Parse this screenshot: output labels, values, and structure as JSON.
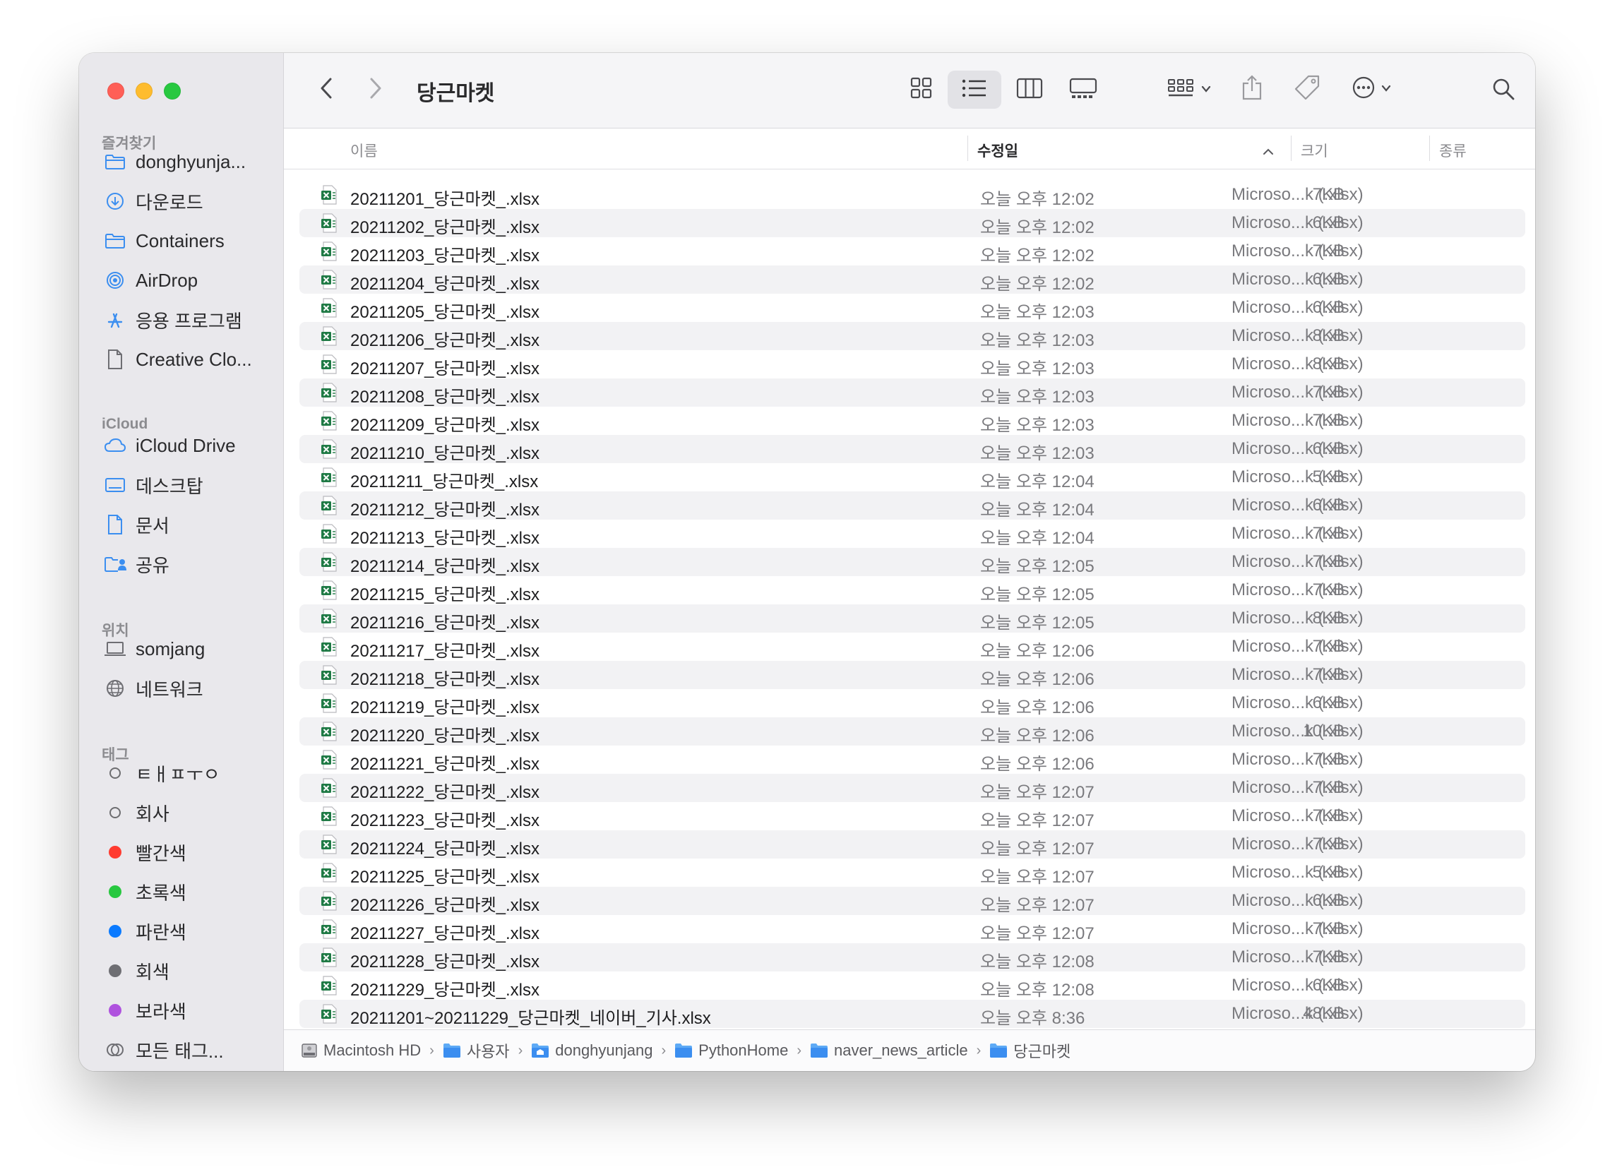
{
  "window": {
    "title": "당근마켓"
  },
  "colors": {
    "close": "#ff5f57",
    "minimize": "#febc2e",
    "zoom": "#28c840",
    "folder_accent": "#3b8ef0",
    "excel_green": "#1f7a45",
    "tag_red": "#ff3b30",
    "tag_green": "#28c840",
    "tag_blue": "#0a7aff",
    "tag_gray": "#8e8e93",
    "tag_purple": "#af52de"
  },
  "sidebar": {
    "favorites_title": "즐겨찾기",
    "favorites": [
      {
        "label": "donghyunja...",
        "icon": "folder-icon"
      },
      {
        "label": "다운로드",
        "icon": "download-icon"
      },
      {
        "label": "Containers",
        "icon": "folder-icon"
      },
      {
        "label": "AirDrop",
        "icon": "airdrop-icon"
      },
      {
        "label": "응용 프로그램",
        "icon": "applications-icon"
      },
      {
        "label": "Creative Clo...",
        "icon": "document-icon"
      }
    ],
    "icloud_title": "iCloud",
    "icloud": [
      {
        "label": "iCloud Drive",
        "icon": "cloud-icon"
      },
      {
        "label": "데스크탑",
        "icon": "desktop-icon"
      },
      {
        "label": "문서",
        "icon": "document-icon"
      },
      {
        "label": "공유",
        "icon": "shared-folder-icon"
      }
    ],
    "locations_title": "위치",
    "locations": [
      {
        "label": "somjang",
        "icon": "laptop-icon"
      },
      {
        "label": "네트워크",
        "icon": "network-icon"
      }
    ],
    "tags_title": "태그",
    "tags": [
      {
        "label": "ㅌㅐㅍㅜㅇ",
        "color": "none"
      },
      {
        "label": "회사",
        "color": "none"
      },
      {
        "label": "빨간색",
        "color": "#ff3b30"
      },
      {
        "label": "초록색",
        "color": "#28c840"
      },
      {
        "label": "파란색",
        "color": "#0a7aff"
      },
      {
        "label": "회색",
        "color": "#6e6e73"
      },
      {
        "label": "보라색",
        "color": "#af52de"
      },
      {
        "label": "모든 태그...",
        "color": "all"
      }
    ]
  },
  "columns": {
    "name": "이름",
    "date": "수정일",
    "size": "크기",
    "kind": "종류"
  },
  "files": [
    {
      "name": "20211201_당근마켓_.xlsx",
      "date": "오늘 오후 12:02",
      "size": "7KB",
      "kind": "Microso...k (.xlsx)"
    },
    {
      "name": "20211202_당근마켓_.xlsx",
      "date": "오늘 오후 12:02",
      "size": "6KB",
      "kind": "Microso...k (.xlsx)"
    },
    {
      "name": "20211203_당근마켓_.xlsx",
      "date": "오늘 오후 12:02",
      "size": "7KB",
      "kind": "Microso...k (.xlsx)"
    },
    {
      "name": "20211204_당근마켓_.xlsx",
      "date": "오늘 오후 12:02",
      "size": "6KB",
      "kind": "Microso...k (.xlsx)"
    },
    {
      "name": "20211205_당근마켓_.xlsx",
      "date": "오늘 오후 12:03",
      "size": "6KB",
      "kind": "Microso...k (.xlsx)"
    },
    {
      "name": "20211206_당근마켓_.xlsx",
      "date": "오늘 오후 12:03",
      "size": "8KB",
      "kind": "Microso...k (.xlsx)"
    },
    {
      "name": "20211207_당근마켓_.xlsx",
      "date": "오늘 오후 12:03",
      "size": "8KB",
      "kind": "Microso...k (.xlsx)"
    },
    {
      "name": "20211208_당근마켓_.xlsx",
      "date": "오늘 오후 12:03",
      "size": "7KB",
      "kind": "Microso...k (.xlsx)"
    },
    {
      "name": "20211209_당근마켓_.xlsx",
      "date": "오늘 오후 12:03",
      "size": "7KB",
      "kind": "Microso...k (.xlsx)"
    },
    {
      "name": "20211210_당근마켓_.xlsx",
      "date": "오늘 오후 12:03",
      "size": "6KB",
      "kind": "Microso...k (.xlsx)"
    },
    {
      "name": "20211211_당근마켓_.xlsx",
      "date": "오늘 오후 12:04",
      "size": "5KB",
      "kind": "Microso...k (.xlsx)"
    },
    {
      "name": "20211212_당근마켓_.xlsx",
      "date": "오늘 오후 12:04",
      "size": "6KB",
      "kind": "Microso...k (.xlsx)"
    },
    {
      "name": "20211213_당근마켓_.xlsx",
      "date": "오늘 오후 12:04",
      "size": "7KB",
      "kind": "Microso...k (.xlsx)"
    },
    {
      "name": "20211214_당근마켓_.xlsx",
      "date": "오늘 오후 12:05",
      "size": "7KB",
      "kind": "Microso...k (.xlsx)"
    },
    {
      "name": "20211215_당근마켓_.xlsx",
      "date": "오늘 오후 12:05",
      "size": "7KB",
      "kind": "Microso...k (.xlsx)"
    },
    {
      "name": "20211216_당근마켓_.xlsx",
      "date": "오늘 오후 12:05",
      "size": "8KB",
      "kind": "Microso...k (.xlsx)"
    },
    {
      "name": "20211217_당근마켓_.xlsx",
      "date": "오늘 오후 12:06",
      "size": "7KB",
      "kind": "Microso...k (.xlsx)"
    },
    {
      "name": "20211218_당근마켓_.xlsx",
      "date": "오늘 오후 12:06",
      "size": "7KB",
      "kind": "Microso...k (.xlsx)"
    },
    {
      "name": "20211219_당근마켓_.xlsx",
      "date": "오늘 오후 12:06",
      "size": "6KB",
      "kind": "Microso...k (.xlsx)"
    },
    {
      "name": "20211220_당근마켓_.xlsx",
      "date": "오늘 오후 12:06",
      "size": "10KB",
      "kind": "Microso...k (.xlsx)"
    },
    {
      "name": "20211221_당근마켓_.xlsx",
      "date": "오늘 오후 12:06",
      "size": "7KB",
      "kind": "Microso...k (.xlsx)"
    },
    {
      "name": "20211222_당근마켓_.xlsx",
      "date": "오늘 오후 12:07",
      "size": "7KB",
      "kind": "Microso...k (.xlsx)"
    },
    {
      "name": "20211223_당근마켓_.xlsx",
      "date": "오늘 오후 12:07",
      "size": "7KB",
      "kind": "Microso...k (.xlsx)"
    },
    {
      "name": "20211224_당근마켓_.xlsx",
      "date": "오늘 오후 12:07",
      "size": "7KB",
      "kind": "Microso...k (.xlsx)"
    },
    {
      "name": "20211225_당근마켓_.xlsx",
      "date": "오늘 오후 12:07",
      "size": "5KB",
      "kind": "Microso...k (.xlsx)"
    },
    {
      "name": "20211226_당근마켓_.xlsx",
      "date": "오늘 오후 12:07",
      "size": "6KB",
      "kind": "Microso...k (.xlsx)"
    },
    {
      "name": "20211227_당근마켓_.xlsx",
      "date": "오늘 오후 12:07",
      "size": "7KB",
      "kind": "Microso...k (.xlsx)"
    },
    {
      "name": "20211228_당근마켓_.xlsx",
      "date": "오늘 오후 12:08",
      "size": "7KB",
      "kind": "Microso...k (.xlsx)"
    },
    {
      "name": "20211229_당근마켓_.xlsx",
      "date": "오늘 오후 12:08",
      "size": "6KB",
      "kind": "Microso...k (.xlsx)"
    },
    {
      "name": "20211201~20211229_당근마켓_네이버_기사.xlsx",
      "date": "오늘 오후 8:36",
      "size": "48KB",
      "kind": "Microso...k (.xlsx)"
    }
  ],
  "pathbar": [
    {
      "label": "Macintosh HD",
      "icon": "disk-icon"
    },
    {
      "label": "사용자",
      "icon": "folder-icon"
    },
    {
      "label": "donghyunjang",
      "icon": "home-folder-icon"
    },
    {
      "label": "PythonHome",
      "icon": "folder-icon"
    },
    {
      "label": "naver_news_article",
      "icon": "folder-icon"
    },
    {
      "label": "당근마켓",
      "icon": "folder-icon"
    }
  ],
  "pathbar_separator": "›"
}
